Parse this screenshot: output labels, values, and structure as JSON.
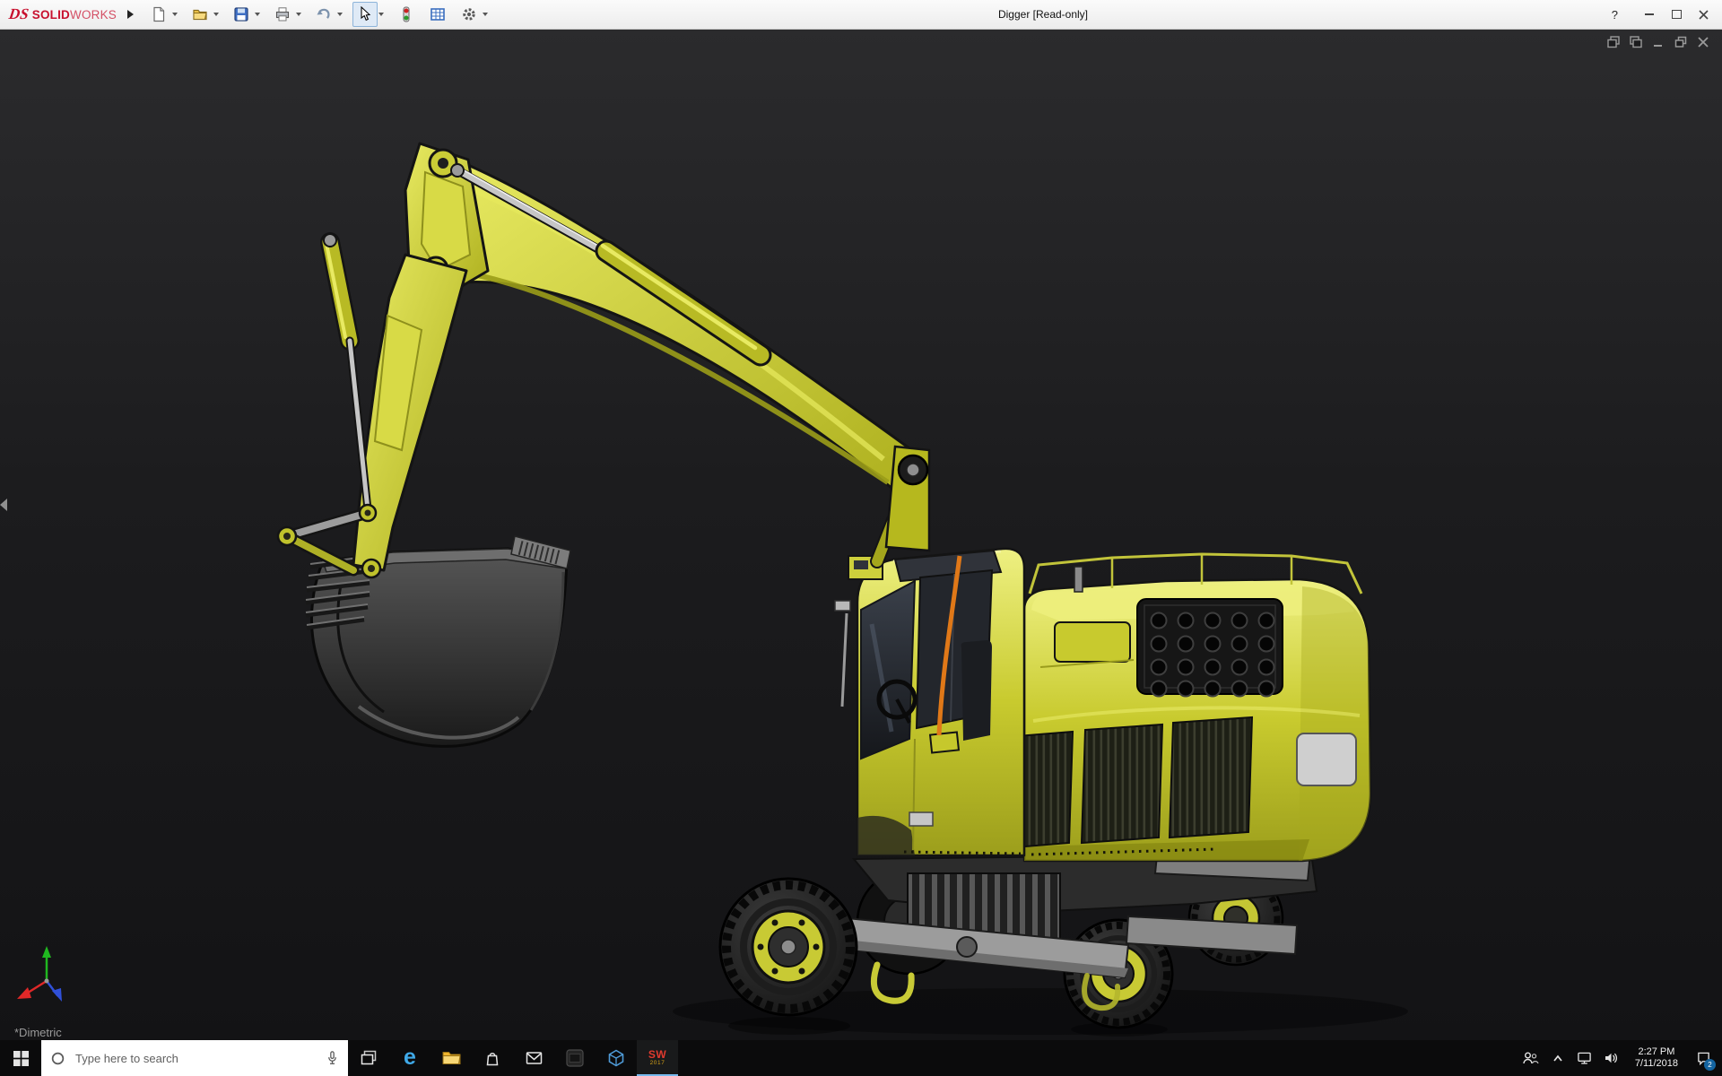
{
  "titlebar": {
    "brand_ds": "DS",
    "brand_solid": "SOLID",
    "brand_works": "WORKS",
    "title": "Digger [Read-only]",
    "help_label": "?",
    "controls": [
      "help",
      "minimize",
      "maximize",
      "close"
    ]
  },
  "toolbar": {
    "icons": [
      "new-document",
      "open",
      "save",
      "print",
      "undo",
      "select",
      "rebuild-stoplight",
      "design-table",
      "options-gear"
    ]
  },
  "viewport": {
    "view_label": "*Dimetric",
    "model": "yellow wheeled excavator (digger)",
    "doc_controls": [
      "window-previous",
      "window-next",
      "minimize",
      "restore",
      "close"
    ],
    "triad_axes": [
      "x-red",
      "y-green",
      "z-blue"
    ]
  },
  "taskbar": {
    "search_placeholder": "Type here to search",
    "edge_glyph": "e",
    "solidworks_label": "SW",
    "solidworks_year": "2017",
    "apps": [
      "start",
      "search",
      "task-view",
      "edge",
      "file-explorer",
      "store",
      "mail",
      "dark-utility-app",
      "3d-app",
      "solidworks-2017"
    ],
    "tray": {
      "icons": [
        "people",
        "show-hidden",
        "network",
        "volume",
        "clock",
        "action-center"
      ],
      "time": "2:27 PM",
      "date": "7/11/2018",
      "notification_count": "2"
    }
  },
  "colors": {
    "body_yellow": "#cdd034",
    "orange_hose": "#e07818",
    "viewport_bg": "#1c1c1e",
    "titlebar_bg": "#f0f0f0",
    "taskbar_bg": "#0b0b0c"
  }
}
